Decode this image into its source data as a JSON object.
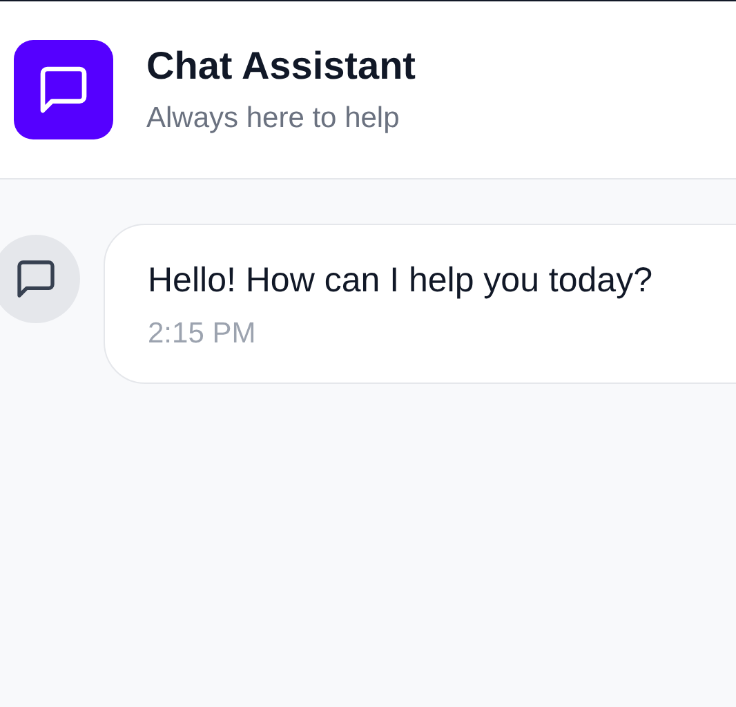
{
  "header": {
    "title": "Chat Assistant",
    "subtitle": "Always here to help"
  },
  "messages": [
    {
      "text": "Hello! How can I help you today?",
      "time": "2:15 PM"
    }
  ]
}
